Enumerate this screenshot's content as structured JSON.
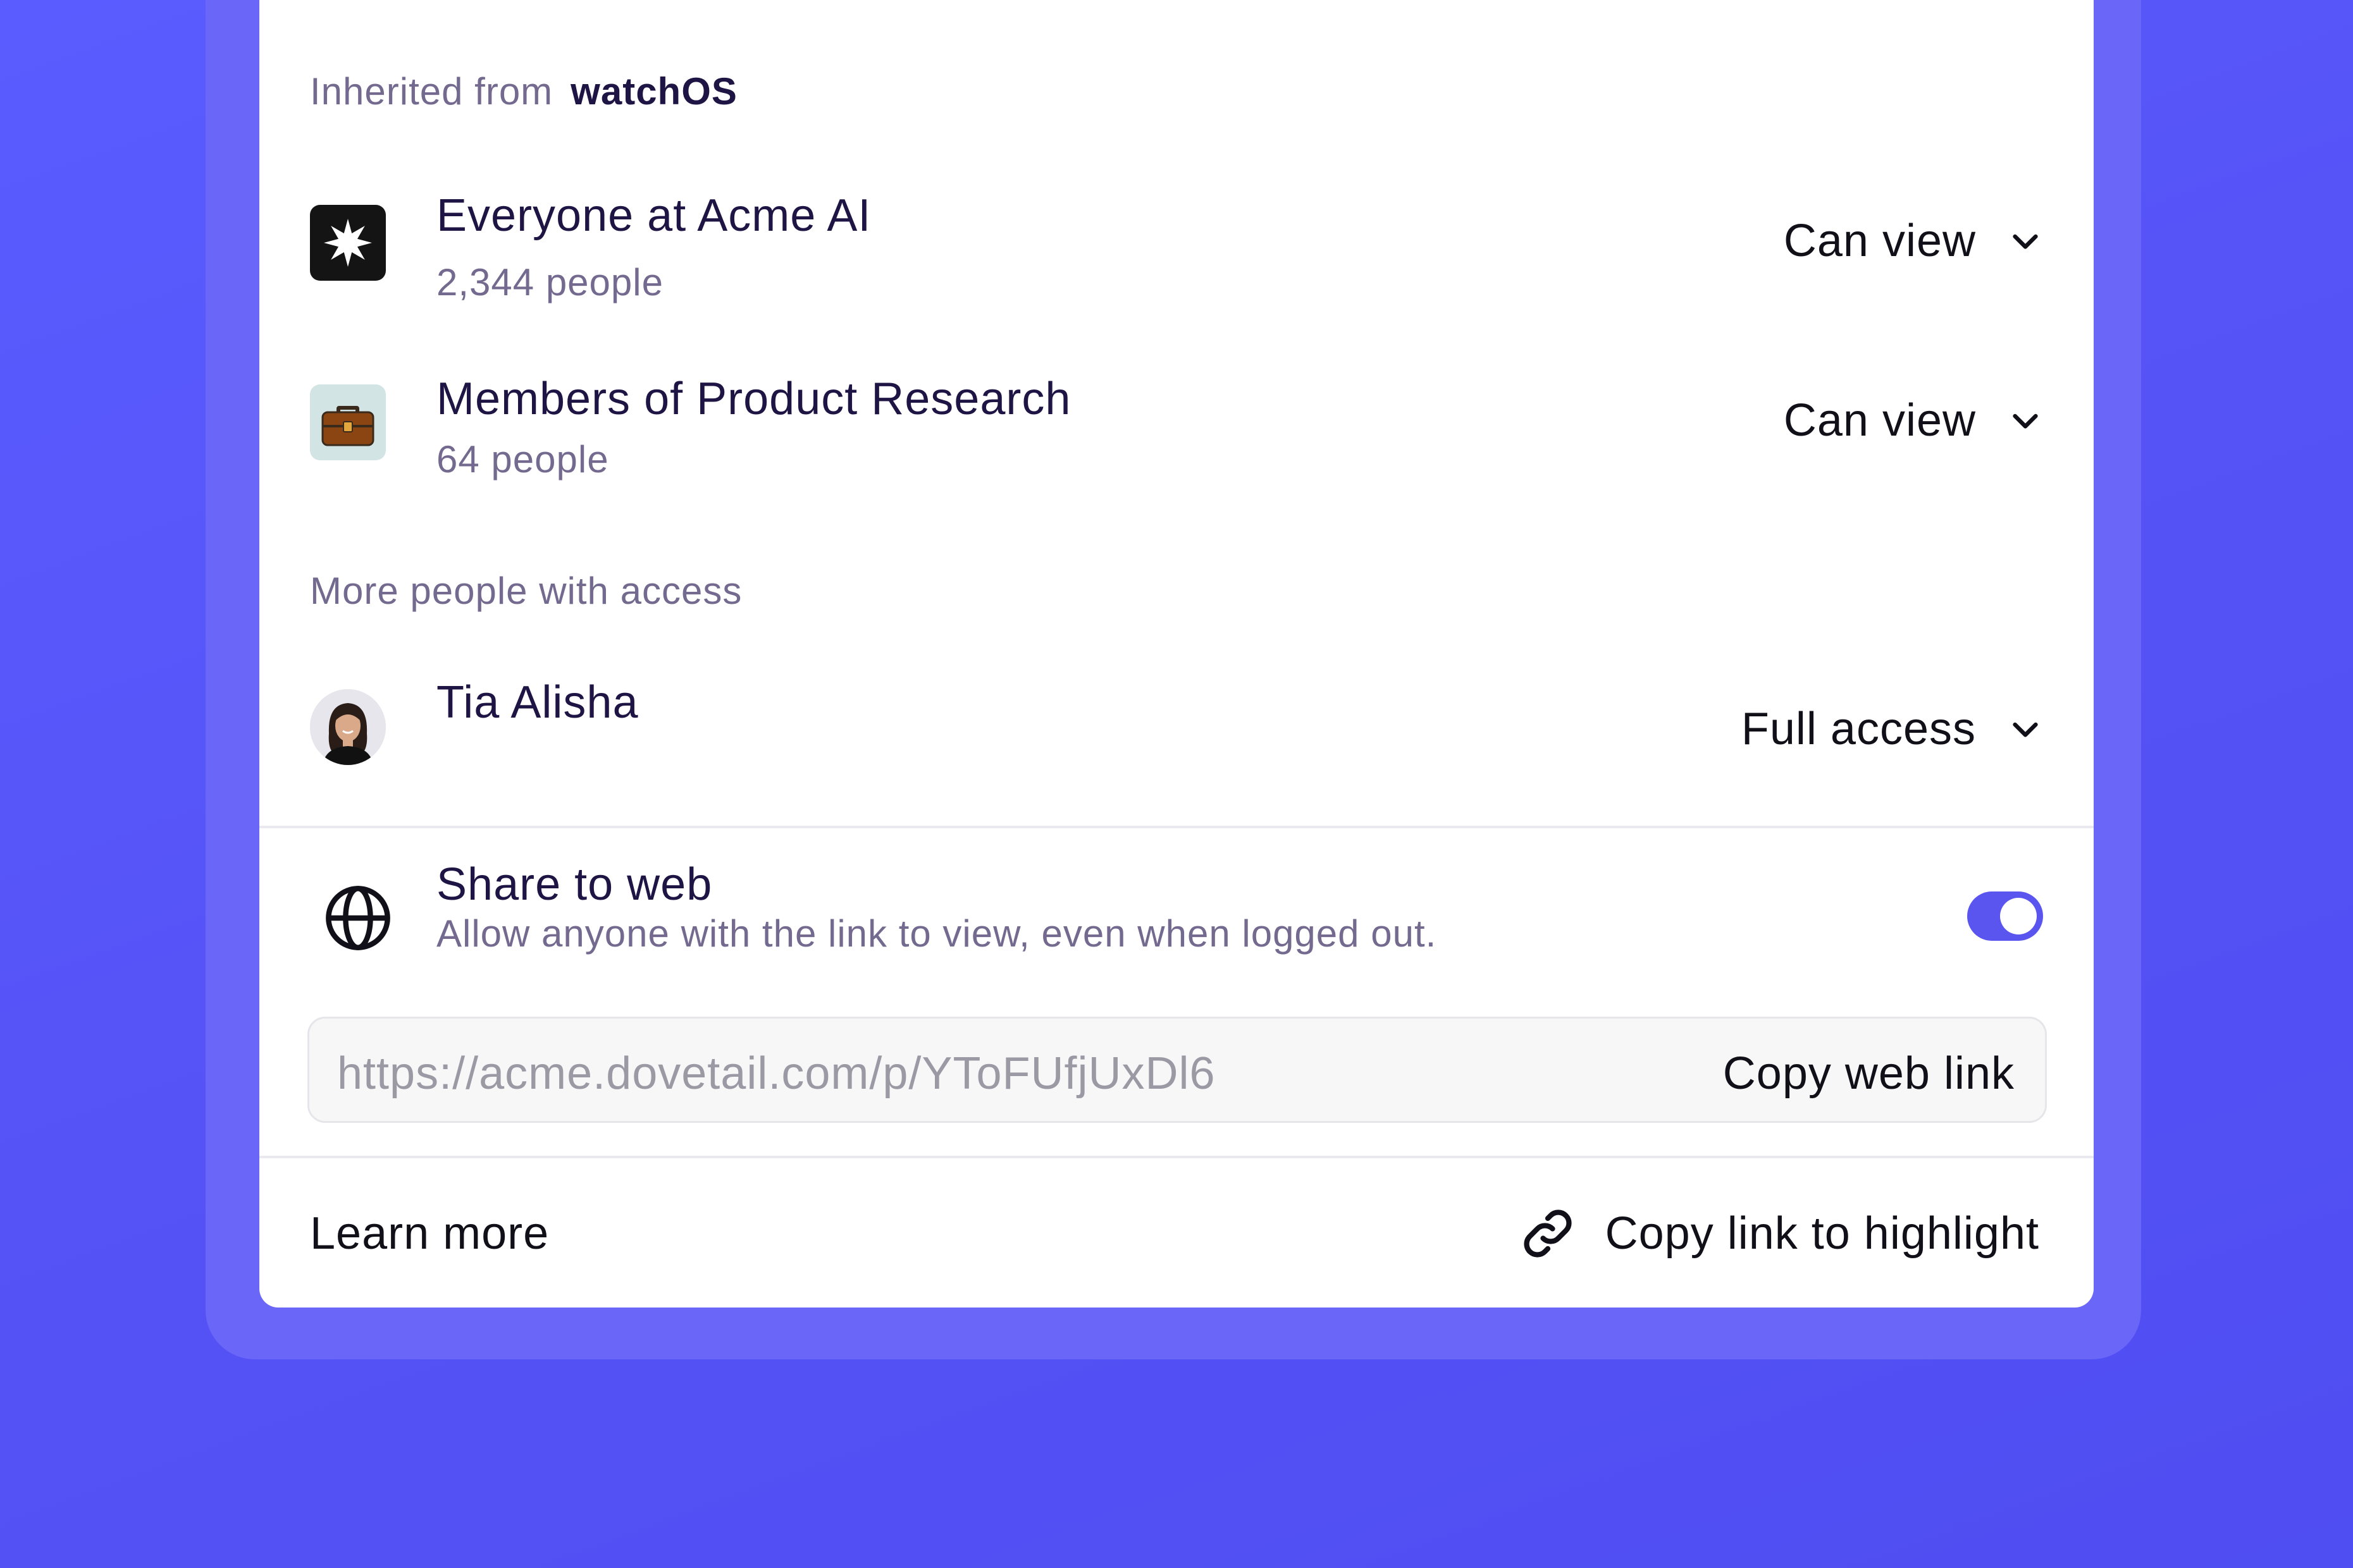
{
  "inherited": {
    "prefix": "Inherited from",
    "source": "watchOS"
  },
  "groups": [
    {
      "name": "Everyone at Acme AI",
      "count": "2,344 people",
      "permission": "Can view",
      "icon": "acme-logo-icon"
    },
    {
      "name": "Members of Product Research",
      "count": "64 people",
      "permission": "Can view",
      "icon": "briefcase-icon"
    }
  ],
  "more_people": {
    "label": "More people with access",
    "people": [
      {
        "name": "Tia Alisha",
        "permission": "Full access",
        "icon": "avatar"
      }
    ]
  },
  "share_web": {
    "title": "Share to web",
    "description": "Allow anyone with the link to view, even when logged out.",
    "enabled": true,
    "url": "https://acme.dovetail.com/p/YToFUfjUxDl6",
    "copy_label": "Copy web link",
    "icon": "globe-icon"
  },
  "footer": {
    "learn_more": "Learn more",
    "copy_highlight": "Copy link to highlight",
    "icon": "link-icon"
  },
  "colors": {
    "background": "#5552f5",
    "frame": "#6a66f8",
    "accent": "#5b55f0",
    "text_dark": "#1f1545",
    "text_muted": "#746a8f"
  }
}
